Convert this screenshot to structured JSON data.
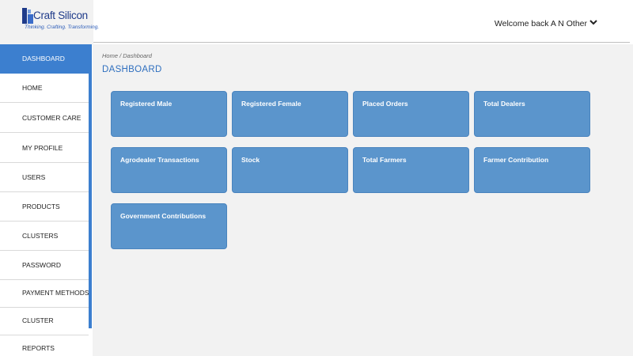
{
  "header": {
    "logo_name": "Craft Silicon",
    "logo_tagline": "Thinking. Crafting. Transforming.",
    "welcome_text": "Welcome back A N Other",
    "brand_color": "#1f3b8a"
  },
  "sidebar": {
    "accent_color": "#3c7fcf",
    "items": [
      {
        "label": "DASHBOARD",
        "active": true
      },
      {
        "label": "HOME"
      },
      {
        "label": "CUSTOMER CARE"
      },
      {
        "label": "MY PROFILE"
      },
      {
        "label": "USERS"
      },
      {
        "label": "PRODUCTS"
      },
      {
        "label": "CLUSTERS"
      },
      {
        "label": "PASSWORD"
      },
      {
        "label": "PAYMENT METHODS"
      },
      {
        "label": "CLUSTER"
      },
      {
        "label": "REPORTS"
      }
    ]
  },
  "main": {
    "breadcrumb": "Home / Dashboard",
    "title": "DASHBOARD",
    "tile_color": "#5b95cc",
    "tiles": [
      {
        "label": "Registered Male"
      },
      {
        "label": "Registered Female"
      },
      {
        "label": "Placed Orders"
      },
      {
        "label": "Total Dealers"
      },
      {
        "label": "Agrodealer Transactions"
      },
      {
        "label": "Stock"
      },
      {
        "label": "Total Farmers"
      },
      {
        "label": "Farmer Contribution"
      },
      {
        "label": "Government Contributions"
      }
    ]
  }
}
